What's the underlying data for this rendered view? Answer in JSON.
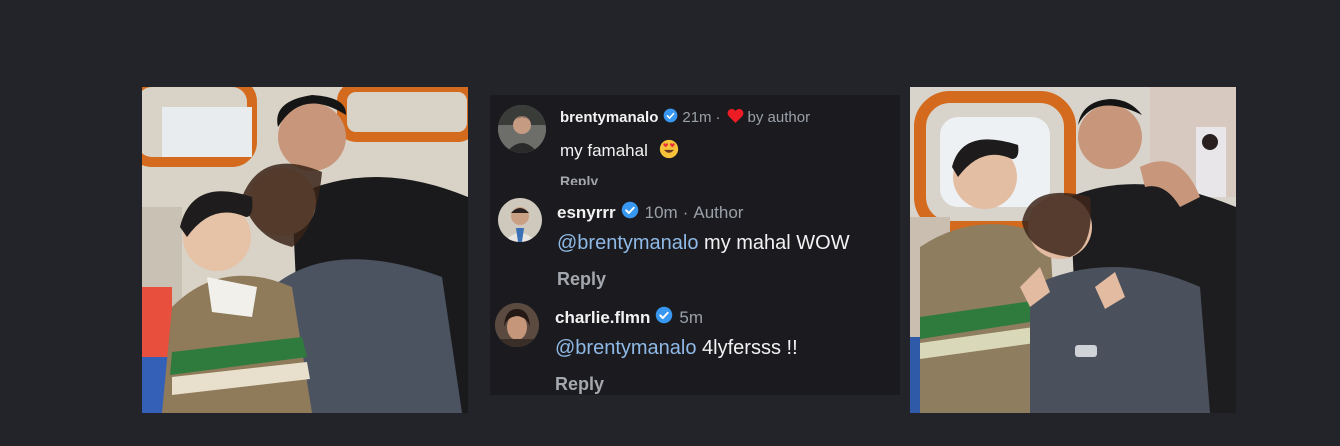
{
  "colors": {
    "background": "#22242a",
    "thread_background": "#1b1b1f",
    "username": "#f2f2f2",
    "meta": "#9aa0a8",
    "mention": "#8fb9e6",
    "verified": "#3897f0",
    "heart": "#ed1c24"
  },
  "photos": {
    "left": {
      "icon": "group-photo"
    },
    "right": {
      "icon": "group-photo"
    }
  },
  "comments": [
    {
      "username": "brentymanalo",
      "verified": true,
      "time": "21m",
      "separator": "·",
      "liked_by": "by author",
      "text": "my famahal",
      "emoji": "heart-eyes-emoji",
      "reply": "Reply"
    },
    {
      "username": "esnyrrr",
      "verified": true,
      "time": "10m",
      "separator": "·",
      "badge": "Author",
      "mention": "@brentymanalo",
      "text": "my mahal WOW",
      "reply": "Reply"
    },
    {
      "username": "charlie.flmn",
      "verified": true,
      "time": "5m",
      "mention": "@brentymanalo",
      "text": "4lyfersss !!",
      "reply": "Reply"
    }
  ]
}
